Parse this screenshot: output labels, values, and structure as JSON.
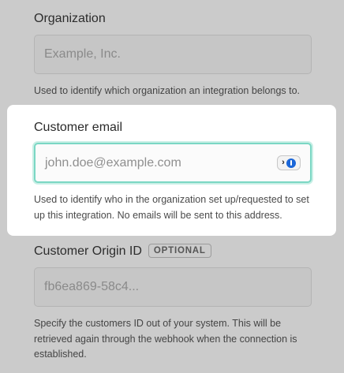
{
  "organization": {
    "label": "Organization",
    "placeholder": "Example, Inc.",
    "help": "Used to identify which organization an integration belongs to."
  },
  "customer_email": {
    "label": "Customer email",
    "placeholder": "john.doe@example.com",
    "help": "Used to identify who in the organization set up/requested to set up this integration. No emails will be sent to this address."
  },
  "customer_origin_id": {
    "label": "Customer Origin ID",
    "badge": "OPTIONAL",
    "placeholder": "fb6ea869-58c4...",
    "help": "Specify the customers ID out of your system. This will be retrieved again through the webhook when the connection is established."
  },
  "colors": {
    "focus_ring": "#7bd7c4",
    "password_manager": "#1a66d8",
    "overlay": "#cbcbcb"
  },
  "icons": {
    "password_manager": "password-manager-icon"
  }
}
